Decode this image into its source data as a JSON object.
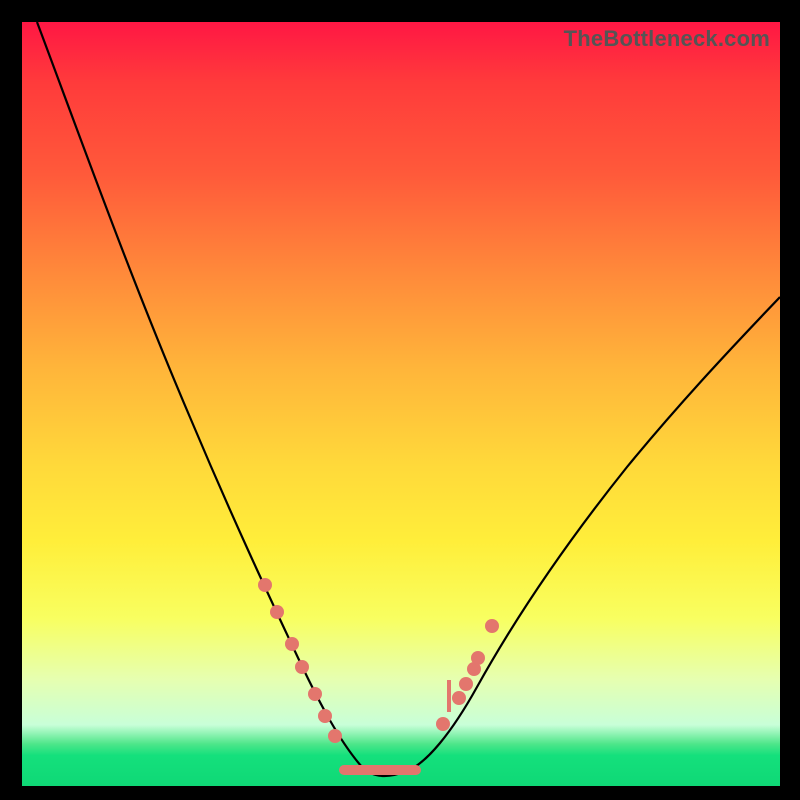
{
  "watermark": "TheBottleneck.com",
  "colors": {
    "frame": "#000000",
    "curve": "#000000",
    "marker": "#e3766d",
    "gradient_top": "#ff1744",
    "gradient_bottom": "#0fd876"
  },
  "chart_data": {
    "type": "line",
    "title": "",
    "xlabel": "",
    "ylabel": "",
    "x_range": [
      0,
      100
    ],
    "y_range": [
      0,
      100
    ],
    "note": "V-shaped bottleneck curve. x is normalized horizontal position (0-100 left→right), y is normalized value where 0 = bottom (green, good) and 100 = top (red, bad). Minimum near x≈47.",
    "series": [
      {
        "name": "bottleneck-curve",
        "x": [
          2,
          6,
          10,
          14,
          18,
          22,
          26,
          30,
          33,
          36,
          38.5,
          41,
          43.5,
          45.5,
          47.5,
          50,
          53,
          56,
          59,
          62,
          66,
          72,
          78,
          85,
          92,
          100
        ],
        "y": [
          100,
          92,
          83,
          74,
          65,
          56,
          47,
          38.5,
          31,
          24.5,
          19,
          13.5,
          8.5,
          4.5,
          2,
          2,
          4,
          8,
          13,
          18.5,
          25,
          32.5,
          39.5,
          46.5,
          53,
          60
        ]
      }
    ],
    "markers": {
      "name": "highlighted-points",
      "x": [
        32.0,
        33.6,
        35.6,
        36.9,
        38.6,
        39.9,
        41.3,
        55.5,
        57.6,
        58.6,
        59.6,
        60.2,
        62.0
      ],
      "y": [
        30.0,
        27.0,
        23.2,
        20.5,
        17.2,
        14.5,
        12.0,
        8.0,
        11.5,
        13.5,
        15.5,
        17.0,
        21.0
      ]
    },
    "flat_segment": {
      "x0": 42.5,
      "x1": 52.0,
      "y": 2.0
    },
    "spike": {
      "x": 56.3,
      "y0": 9.0,
      "y1": 14.0
    }
  }
}
